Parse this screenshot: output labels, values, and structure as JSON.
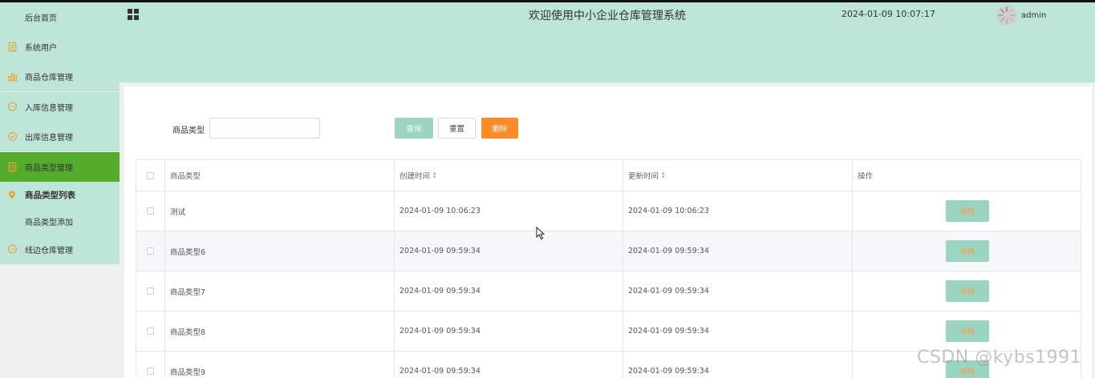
{
  "header": {
    "title": "欢迎使用中小企业仓库管理系统",
    "datetime": "2024-01-09 10:07:17",
    "username": "admin"
  },
  "sidebar": {
    "items": [
      {
        "label": "后台首页",
        "icon": ""
      },
      {
        "label": "系统用户",
        "icon": "document-icon"
      },
      {
        "label": "商品仓库管理",
        "icon": "bar-chart-icon"
      },
      {
        "label": "入库信息管理",
        "icon": "chat-icon"
      },
      {
        "label": "出库信息管理",
        "icon": "check-circle-icon"
      },
      {
        "label": "商品类型管理",
        "icon": "document-icon"
      },
      {
        "label": "商品类型列表",
        "icon": "location-pin-icon"
      },
      {
        "label": "商品类型添加",
        "icon": ""
      },
      {
        "label": "线边仓库管理",
        "icon": "chat-icon"
      }
    ]
  },
  "filter": {
    "label": "商品类型",
    "value": "",
    "placeholder": "",
    "query_label": "查询",
    "reset_label": "重置",
    "delete_label": "删除"
  },
  "table": {
    "columns": [
      "商品类型",
      "创建时间",
      "更新时间",
      "操作"
    ],
    "rows": [
      {
        "type": "测试",
        "created": "2024-01-09 10:06:23",
        "updated": "2024-01-09 10:06:23",
        "action": "详情"
      },
      {
        "type": "商品类型6",
        "created": "2024-01-09 09:59:34",
        "updated": "2024-01-09 09:59:34",
        "action": "详情"
      },
      {
        "type": "商品类型7",
        "created": "2024-01-09 09:59:34",
        "updated": "2024-01-09 09:59:34",
        "action": "详情"
      },
      {
        "type": "商品类型8",
        "created": "2024-01-09 09:59:34",
        "updated": "2024-01-09 09:59:34",
        "action": "详情"
      },
      {
        "type": "商品类型9",
        "created": "2024-01-09 09:59:34",
        "updated": "2024-01-09 09:59:34",
        "action": "详情"
      }
    ]
  },
  "watermark": "CSDN @kybs1991",
  "colors": {
    "header_bg": "#bde5d8",
    "sidebar_active": "#55ac2c",
    "query_button": "#9bd4c0",
    "delete_button": "#ff8a28",
    "icon_orange": "#f0a030"
  }
}
